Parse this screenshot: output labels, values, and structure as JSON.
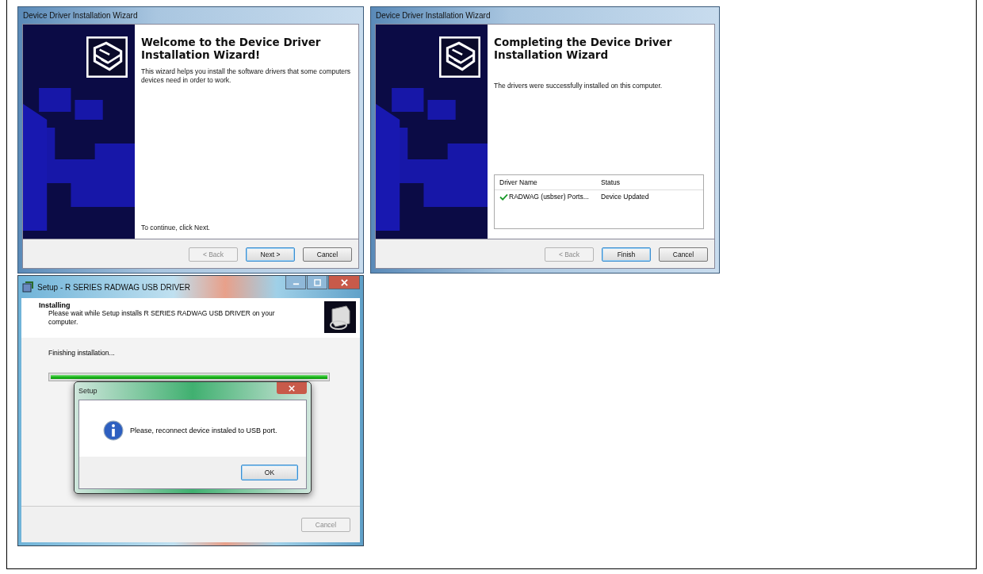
{
  "wizards": [
    {
      "title": "Device Driver Installation Wizard",
      "heading": "Welcome to the Device Driver Installation Wizard!",
      "body": "This wizard helps you install the software drivers that some computers devices need in order to work.",
      "footer": "To continue, click Next.",
      "buttons": [
        {
          "label": "< Back",
          "disabled": true,
          "default": false
        },
        {
          "label": "Next >",
          "disabled": false,
          "default": true
        },
        {
          "label": "Cancel",
          "disabled": false,
          "default": false
        }
      ]
    },
    {
      "title": "Device Driver Installation Wizard",
      "heading": "Completing the Device Driver Installation Wizard",
      "body": "The drivers were successfully installed on this computer.",
      "table": {
        "columns": [
          "Driver Name",
          "Status"
        ],
        "rows": [
          {
            "cells": [
              "RADWAG (usbser) Ports...",
              "Device Updated"
            ],
            "success": true
          }
        ]
      },
      "buttons": [
        {
          "label": "< Back",
          "disabled": true,
          "default": false
        },
        {
          "label": "Finish",
          "disabled": false,
          "default": true
        },
        {
          "label": "Cancel",
          "disabled": false,
          "default": false
        }
      ]
    }
  ],
  "setup": {
    "title": "Setup - R SERIES RADWAG USB DRIVER",
    "section": "Installing",
    "subtitle": "Please wait while Setup installs R SERIES RADWAG USB DRIVER on your computer.",
    "status": "Finishing installation...",
    "progress": {
      "level": 1
    },
    "buttons": [
      {
        "label": "Cancel",
        "disabled": true,
        "default": false
      }
    ],
    "message_box": {
      "title": "Setup",
      "message": "Please, reconnect device instaled to USB port.",
      "buttons": [
        {
          "label": "OK",
          "disabled": false,
          "default": true
        }
      ]
    }
  }
}
